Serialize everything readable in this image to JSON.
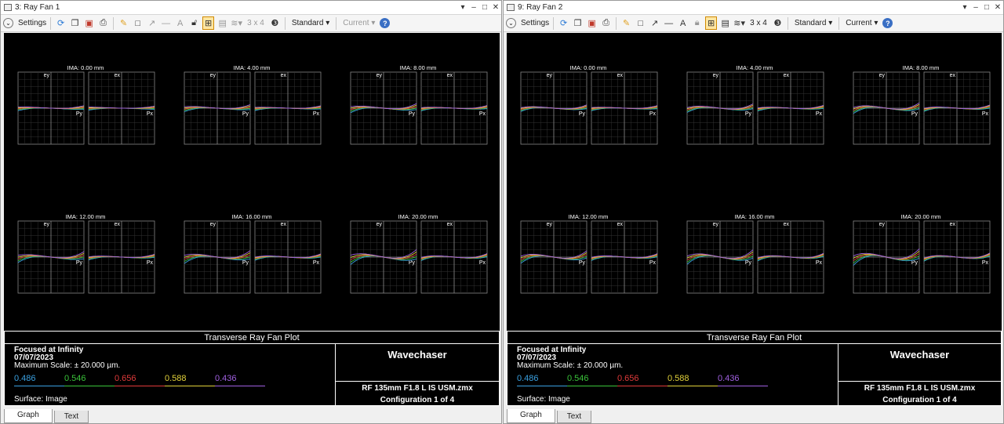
{
  "windows": [
    {
      "title": "3: Ray Fan 1",
      "toolbar": {
        "settings_label": "Settings",
        "layout_label": "3 x 4",
        "standard_label": "Standard",
        "current_label": "Current"
      },
      "plots": [
        {
          "label": "IMA: 0.00 mm",
          "left_axis": "ey",
          "right_axis": "ex",
          "left_end": "Py",
          "right_end": "Px"
        },
        {
          "label": "IMA: 4.00 mm",
          "left_axis": "ey",
          "right_axis": "ex",
          "left_end": "Py",
          "right_end": "Px"
        },
        {
          "label": "IMA: 8.00 mm",
          "left_axis": "ey",
          "right_axis": "ex",
          "left_end": "Py",
          "right_end": "Px"
        },
        {
          "label": "IMA: 12.00 mm",
          "left_axis": "ey",
          "right_axis": "ex",
          "left_end": "Py",
          "right_end": "Px"
        },
        {
          "label": "IMA: 16.00 mm",
          "left_axis": "ey",
          "right_axis": "ex",
          "left_end": "Py",
          "right_end": "Px"
        },
        {
          "label": "IMA: 20.00 mm",
          "left_axis": "ey",
          "right_axis": "ex",
          "left_end": "Py",
          "right_end": "Px"
        }
      ],
      "info": {
        "plot_title": "Transverse Ray Fan Plot",
        "line1": "Focused at Infinity",
        "line2": "07/07/2023",
        "line3": "Maximum Scale: ± 20.000 µm.",
        "surface": "Surface: Image",
        "company": "Wavechaser",
        "file": "RF 135mm F1.8 L IS USM.zmx",
        "config": "Configuration 1 of 4"
      },
      "tabs": [
        "Graph",
        "Text"
      ]
    },
    {
      "title": "9: Ray Fan 2",
      "toolbar": {
        "settings_label": "Settings",
        "layout_label": "3 x 4",
        "standard_label": "Standard",
        "current_label": "Current"
      },
      "plots": [
        {
          "label": "IMA: 0.00 mm",
          "left_axis": "ey",
          "right_axis": "ex",
          "left_end": "Py",
          "right_end": "Px"
        },
        {
          "label": "IMA: 4.00 mm",
          "left_axis": "ey",
          "right_axis": "ex",
          "left_end": "Py",
          "right_end": "Px"
        },
        {
          "label": "IMA: 8.00 mm",
          "left_axis": "ey",
          "right_axis": "ex",
          "left_end": "Py",
          "right_end": "Px"
        },
        {
          "label": "IMA: 12.00 mm",
          "left_axis": "ey",
          "right_axis": "ex",
          "left_end": "Py",
          "right_end": "Px"
        },
        {
          "label": "IMA: 16.00 mm",
          "left_axis": "ey",
          "right_axis": "ex",
          "left_end": "Py",
          "right_end": "Px"
        },
        {
          "label": "IMA: 20.00 mm",
          "left_axis": "ey",
          "right_axis": "ex",
          "left_end": "Py",
          "right_end": "Px"
        }
      ],
      "info": {
        "plot_title": "Transverse Ray Fan Plot",
        "line1": "Focused at Infinity",
        "line2": "07/07/2023",
        "line3": "Maximum Scale: ± 20.000 µm.",
        "surface": "Surface: Image",
        "company": "Wavechaser",
        "file": "RF 135mm F1.8 L IS USM.zmx",
        "config": "Configuration 1 of 4"
      },
      "tabs": [
        "Graph",
        "Text"
      ]
    }
  ],
  "wavelengths": [
    {
      "label": "0.486",
      "color": "#3aa0e0"
    },
    {
      "label": "0.546",
      "color": "#3ac43a"
    },
    {
      "label": "0.656",
      "color": "#e03a3a"
    },
    {
      "label": "0.588",
      "color": "#e0d03a"
    },
    {
      "label": "0.436",
      "color": "#a060e0"
    }
  ]
}
